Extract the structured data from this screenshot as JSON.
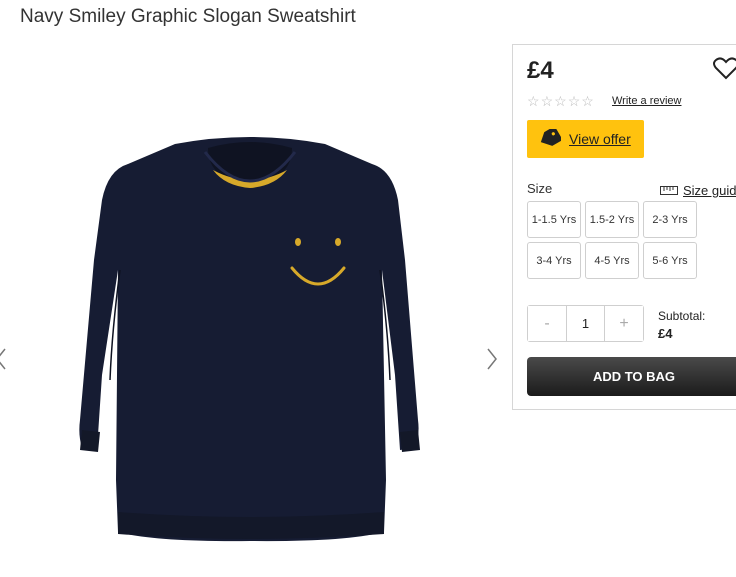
{
  "product": {
    "title": "Navy Smiley Graphic Slogan Sweatshirt",
    "image_icon": "navy-sweatshirt-image"
  },
  "gallery": {
    "prev_icon": "chevron-left-icon",
    "next_icon": "chevron-right-icon"
  },
  "panel": {
    "price": "£4",
    "wishlist_icon": "heart-icon",
    "rating_stars": 0,
    "rating_max": 5,
    "write_review_label": "Write a review",
    "offer_label": "View offer",
    "offer_color": "#ffc20e",
    "size_label": "Size",
    "size_guide_label": "Size guide",
    "sizes": [
      "1-1.5 Yrs",
      "1.5-2 Yrs",
      "2-3 Yrs",
      "3-4 Yrs",
      "4-5 Yrs",
      "5-6 Yrs"
    ],
    "quantity": {
      "minus_label": "-",
      "value": "1",
      "plus_label": "+"
    },
    "subtotal_label": "Subtotal:",
    "subtotal_value": "£4",
    "add_to_bag_label": "ADD TO BAG"
  },
  "colors": {
    "sweatshirt": "#161c33",
    "smiley": "#d7a92a"
  }
}
